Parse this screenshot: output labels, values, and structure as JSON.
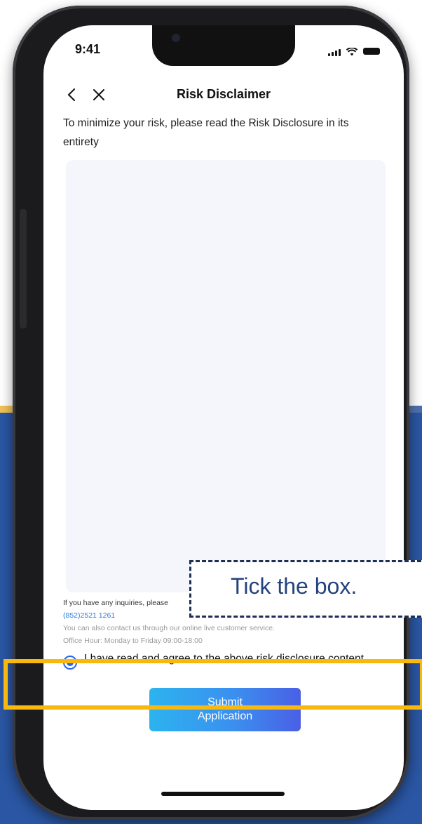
{
  "status_bar": {
    "time": "9:41"
  },
  "header": {
    "title": "Risk Disclaimer",
    "back_icon": "chevron-left-icon",
    "close_icon": "close-icon"
  },
  "intro_text": "To minimize your risk, please read the Risk Disclosure in its entirety",
  "contact": {
    "inquiry_text": "If you have any inquiries, please",
    "phone": "(852)2521 1261",
    "live_service_text": "You can also contact us through our online live customer service.",
    "office_hours": "Office Hour: Monday to Friday 09:00-18:00"
  },
  "agreement": {
    "checked": true,
    "label": "I have read and agree to the above risk disclosure content"
  },
  "submit_button": {
    "label": "Submit Application"
  },
  "annotation": {
    "callout_text": "Tick the box."
  },
  "colors": {
    "accent_blue": "#2a66e6",
    "button_gradient_start": "#2cb3ef",
    "button_gradient_end": "#4a5fe5",
    "highlight_yellow": "#f8b80d",
    "background_band": "#2a56a3"
  }
}
